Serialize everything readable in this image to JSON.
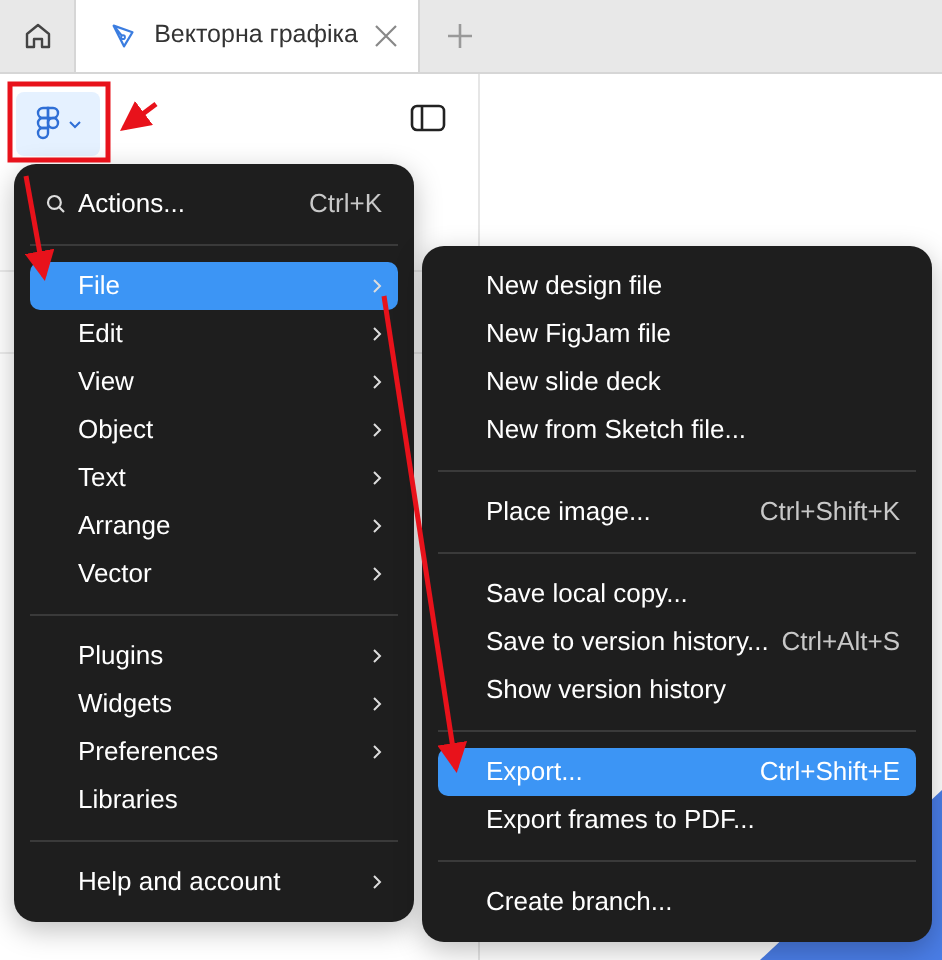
{
  "tabs": [
    {
      "kind": "home",
      "selected": false
    },
    {
      "kind": "document",
      "label": "Векторна графіка",
      "selected": true
    }
  ],
  "main_menu": {
    "items": [
      {
        "kind": "search",
        "label": "Actions...",
        "shortcut": "Ctrl+K",
        "selected": false
      },
      {
        "kind": "separator"
      },
      {
        "kind": "item",
        "label": "File",
        "submenu": true,
        "selected": true
      },
      {
        "kind": "item",
        "label": "Edit",
        "submenu": true,
        "selected": false
      },
      {
        "kind": "item",
        "label": "View",
        "submenu": true,
        "selected": false
      },
      {
        "kind": "item",
        "label": "Object",
        "submenu": true,
        "selected": false
      },
      {
        "kind": "item",
        "label": "Text",
        "submenu": true,
        "selected": false
      },
      {
        "kind": "item",
        "label": "Arrange",
        "submenu": true,
        "selected": false
      },
      {
        "kind": "item",
        "label": "Vector",
        "submenu": true,
        "selected": false
      },
      {
        "kind": "separator"
      },
      {
        "kind": "item",
        "label": "Plugins",
        "submenu": true,
        "selected": false
      },
      {
        "kind": "item",
        "label": "Widgets",
        "submenu": true,
        "selected": false
      },
      {
        "kind": "item",
        "label": "Preferences",
        "submenu": true,
        "selected": false
      },
      {
        "kind": "item",
        "label": "Libraries",
        "submenu": false,
        "selected": false
      },
      {
        "kind": "separator"
      },
      {
        "kind": "item",
        "label": "Help and account",
        "submenu": true,
        "selected": false
      }
    ]
  },
  "file_submenu": {
    "items": [
      {
        "kind": "item",
        "label": "New design file",
        "selected": false
      },
      {
        "kind": "item",
        "label": "New FigJam file",
        "selected": false
      },
      {
        "kind": "item",
        "label": "New slide deck",
        "selected": false
      },
      {
        "kind": "item",
        "label": "New from Sketch file...",
        "selected": false
      },
      {
        "kind": "separator"
      },
      {
        "kind": "item",
        "label": "Place image...",
        "shortcut": "Ctrl+Shift+K",
        "selected": false
      },
      {
        "kind": "separator"
      },
      {
        "kind": "item",
        "label": "Save local copy...",
        "selected": false
      },
      {
        "kind": "item",
        "label": "Save to version history...",
        "shortcut": "Ctrl+Alt+S",
        "selected": false
      },
      {
        "kind": "item",
        "label": "Show version history",
        "selected": false
      },
      {
        "kind": "separator"
      },
      {
        "kind": "item",
        "label": "Export...",
        "shortcut": "Ctrl+Shift+E",
        "selected": true
      },
      {
        "kind": "item",
        "label": "Export frames to PDF...",
        "selected": false
      },
      {
        "kind": "separator"
      },
      {
        "kind": "item",
        "label": "Create branch...",
        "selected": false
      }
    ]
  }
}
